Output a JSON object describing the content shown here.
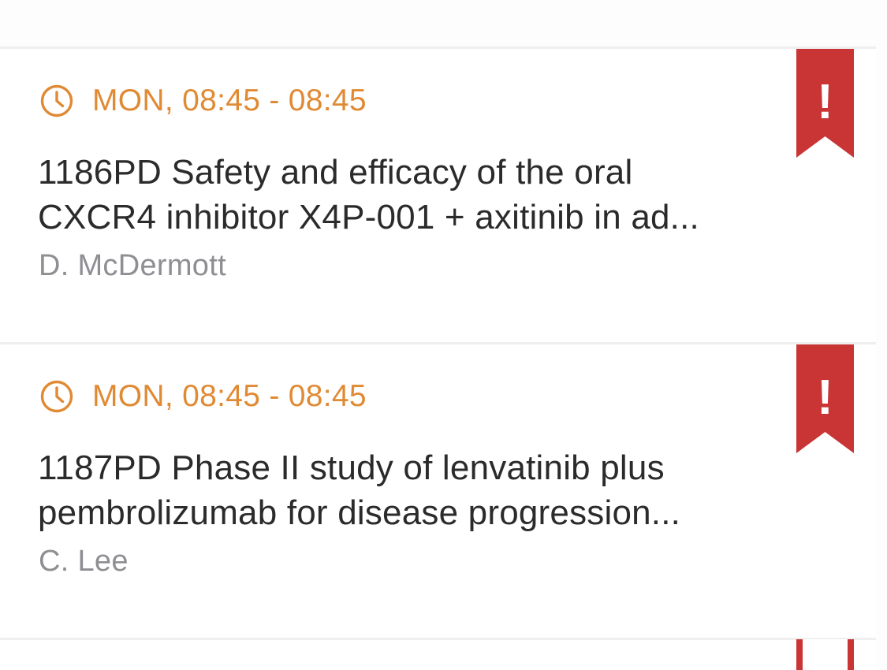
{
  "colors": {
    "accent_orange": "#e08a34",
    "bookmark_red": "#c93535",
    "title_text": "#2b2b2b",
    "presenter_text": "#8e8e93",
    "divider": "#efefef"
  },
  "sessions": [
    {
      "time": "MON, 08:45 - 08:45",
      "title_line1": "1186PD Safety and efficacy of the oral",
      "title_line2": "CXCR4 inhibitor X4P-001 + axitinib in ad...",
      "presenter": "D. McDermott",
      "bookmark_icon": "exclamation-bookmark-icon",
      "bookmark_mark": "!"
    },
    {
      "time": "MON, 08:45 - 08:45",
      "title_line1": "1187PD Phase II study of lenvatinib plus",
      "title_line2": "pembrolizumab for disease progression...",
      "presenter": "C. Lee",
      "bookmark_icon": "exclamation-bookmark-icon",
      "bookmark_mark": "!"
    }
  ]
}
